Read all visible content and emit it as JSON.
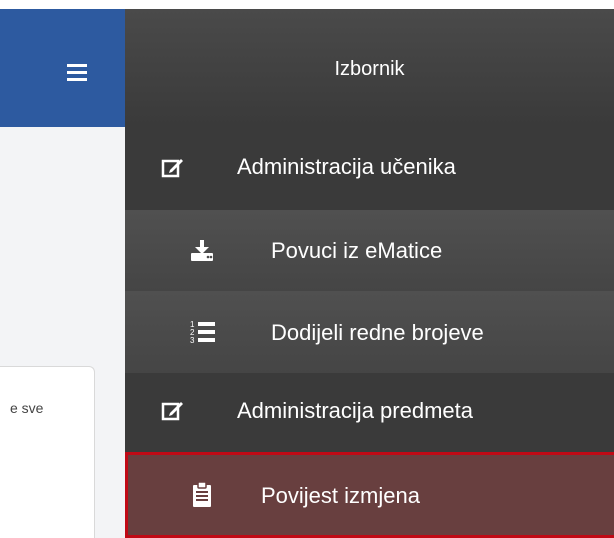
{
  "header": {
    "hamburger_icon": "hamburger-menu-icon"
  },
  "left": {
    "card_text": "e sve"
  },
  "menu": {
    "title": "Izbornik",
    "items": [
      {
        "label": "Administracija učenika",
        "icon": "edit-icon"
      },
      {
        "label": "Povuci iz eMatice",
        "icon": "download-tray-icon"
      },
      {
        "label": "Dodijeli redne brojeve",
        "icon": "ordered-list-icon"
      },
      {
        "label": "Administracija predmeta",
        "icon": "edit-icon"
      },
      {
        "label": "Povijest izmjena",
        "icon": "clipboard-icon"
      }
    ],
    "colors": {
      "header_blue": "#2d5aa0",
      "active_bg": "#683f3f",
      "active_border": "#c00a16"
    }
  }
}
